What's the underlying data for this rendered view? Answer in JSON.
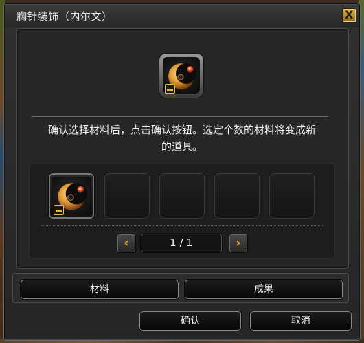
{
  "window": {
    "title": "胸针装饰（内尔文）",
    "close_label": "X"
  },
  "preview_item": {
    "icon": "crescent-moon-brooch-icon",
    "badge_icon": "lock-badge-icon"
  },
  "instruction": {
    "line1": "确认选择材料后，点击确认按钮。选定个数的材料将变成新",
    "line2": "的道具。"
  },
  "material_slots": [
    {
      "filled": true,
      "icon": "crescent-moon-brooch-icon"
    },
    {
      "filled": false
    },
    {
      "filled": false
    },
    {
      "filled": false
    },
    {
      "filled": false
    }
  ],
  "pagination": {
    "text": "1 / 1",
    "prev_icon": "chevron-left-icon",
    "next_icon": "chevron-right-icon"
  },
  "tabs": {
    "materials_label": "材料",
    "results_label": "成果"
  },
  "actions": {
    "confirm_label": "确认",
    "cancel_label": "取消"
  },
  "colors": {
    "accent_gold": "#e4b84a",
    "arrow_orange": "#f0a020",
    "panel_bg": "#262626"
  }
}
